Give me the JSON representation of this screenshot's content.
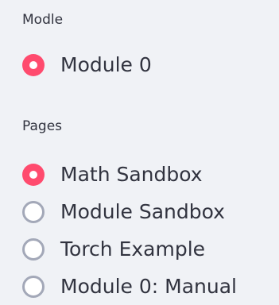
{
  "module_group": {
    "label": "Modle",
    "options": [
      {
        "label": "Module 0",
        "selected": true
      }
    ]
  },
  "pages_group": {
    "label": "Pages",
    "options": [
      {
        "label": "Math Sandbox",
        "selected": true
      },
      {
        "label": "Module Sandbox",
        "selected": false
      },
      {
        "label": "Torch Example",
        "selected": false
      },
      {
        "label": "Module 0: Manual",
        "selected": false
      }
    ]
  },
  "colors": {
    "background": "#f0f2f6",
    "text": "#31333f",
    "accent": "#ff4b6e",
    "radio_border": "#a3a8b8"
  }
}
